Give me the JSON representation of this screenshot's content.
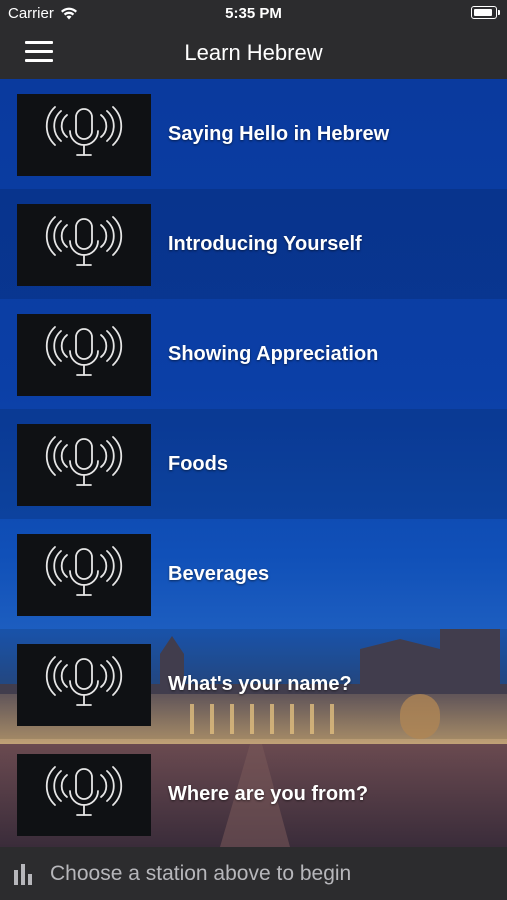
{
  "status": {
    "carrier": "Carrier",
    "time": "5:35 PM"
  },
  "header": {
    "title": "Learn Hebrew",
    "menu_icon": "hamburger-menu-icon"
  },
  "lessons": [
    {
      "label": "Saying Hello in Hebrew",
      "icon": "microphone-broadcast-icon"
    },
    {
      "label": "Introducing Yourself",
      "icon": "microphone-broadcast-icon"
    },
    {
      "label": "Showing Appreciation",
      "icon": "microphone-broadcast-icon"
    },
    {
      "label": "Foods",
      "icon": "microphone-broadcast-icon"
    },
    {
      "label": "Beverages",
      "icon": "microphone-broadcast-icon"
    },
    {
      "label": "What's your name?",
      "icon": "microphone-broadcast-icon"
    },
    {
      "label": "Where are you from?",
      "icon": "microphone-broadcast-icon"
    }
  ],
  "player": {
    "text": "Choose a station above to begin",
    "icon": "equalizer-bars-icon"
  },
  "colors": {
    "bar_bg": "#2c2c2e",
    "list_top": "#0a3a9e",
    "thumb_bg": "#0f1114"
  }
}
